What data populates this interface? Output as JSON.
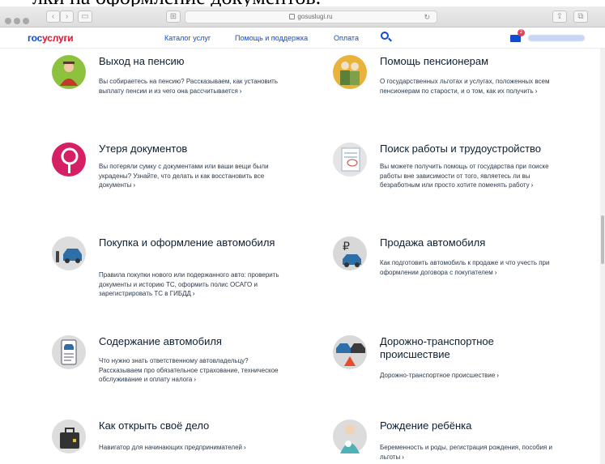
{
  "caption": "лки на оформление документов.",
  "browser": {
    "address": "gosuslugi.ru"
  },
  "header": {
    "logo_part1": "гос",
    "logo_part2": "услуги",
    "nav": [
      "Каталог услуг",
      "Помощь и поддержка",
      "Оплата"
    ],
    "mail_badge": "2"
  },
  "cards": [
    {
      "title": "Выход на пенсию",
      "desc": "Вы собираетесь на пенсию? Рассказываем, как установить выплату пенсии и из чего она рассчитывается"
    },
    {
      "title": "Помощь пенсионерам",
      "desc": "О государственных льготах и услугах, положенных всем пенсионерам по старости, и о том, как их получить"
    },
    {
      "title": "Утеря документов",
      "desc": "Вы потеряли сумку с документами или ваши вещи были украдены? Узнайте, что делать и как восстановить все документы"
    },
    {
      "title": "Поиск работы и трудоустройство",
      "desc": "Вы можете получить помощь от государства при поиске работы вне зависимости от того, являетесь ли вы безработным или просто хотите поменять работу"
    },
    {
      "title": "Покупка и оформление автомобиля",
      "desc": "Правила покупки нового или подержанного авто: проверить документы и историю ТС, оформить полис ОСАГО и зарегистрировать ТС в ГИБДД"
    },
    {
      "title": "Продажа автомобиля",
      "desc": "Как подготовить автомобиль к продаже и что учесть при оформлении договора с покупателем"
    },
    {
      "title": "Содержание автомобиля",
      "desc": "Что нужно знать ответственному автовладельцу? Рассказываем про обязательное страхование, техническое обслуживание и оплату налога"
    },
    {
      "title": "Дорожно-транспортное происшествие",
      "desc": "Дорожно-транспортное происшествие"
    },
    {
      "title": "Как открыть своё дело",
      "desc": "Навигатор для начинающих предпринимателей"
    },
    {
      "title": "Рождение ребёнка",
      "desc": "Беременность и роды, регистрация рождения, пособия и льготы"
    }
  ],
  "icons": [
    "pension-icon",
    "pensioners-icon",
    "lost-documents-icon",
    "job-search-icon",
    "buy-car-icon",
    "sell-car-icon",
    "car-maintenance-icon",
    "road-accident-icon",
    "business-icon",
    "baby-icon"
  ]
}
